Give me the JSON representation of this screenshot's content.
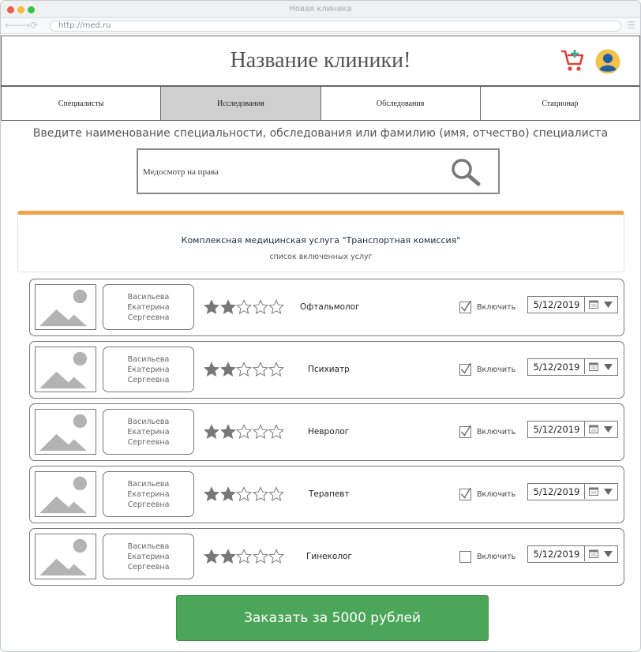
{
  "window": {
    "title": "Новая клиника",
    "url": "http://med.ru"
  },
  "header": {
    "clinic_name": "Название клиники!"
  },
  "tabs": [
    {
      "label": "Специалисты",
      "active": false
    },
    {
      "label": "Исследования",
      "active": true
    },
    {
      "label": "Обследования",
      "active": false
    },
    {
      "label": "Стационар",
      "active": false
    }
  ],
  "search": {
    "hint": "Введите наименование специальности, обследования или фамилию (имя, отчество) специалиста",
    "value": "Медосмотр на права"
  },
  "service": {
    "title": "Комплексная медицинская услуга \"Транспортная комиссия\"",
    "subtitle": "список включенных услуг"
  },
  "specialists": [
    {
      "last": "Васильева",
      "first": "Екатерина",
      "patronymic": "Сергеевна",
      "rating": 2,
      "max_rating": 5,
      "specialty": "Офтальмолог",
      "included": true,
      "include_label": "Включить",
      "date": "5/12/2019"
    },
    {
      "last": "Васильева",
      "first": "Екатерина",
      "patronymic": "Сергеевна",
      "rating": 2,
      "max_rating": 5,
      "specialty": "Психиатр",
      "included": true,
      "include_label": "Включить",
      "date": "5/12/2019"
    },
    {
      "last": "Васильева",
      "first": "Екатерина",
      "patronymic": "Сергеевна",
      "rating": 2,
      "max_rating": 5,
      "specialty": "Невролог",
      "included": true,
      "include_label": "Включить",
      "date": "5/12/2019"
    },
    {
      "last": "Васильева",
      "first": "Екатерина",
      "patronymic": "Сергеевна",
      "rating": 2,
      "max_rating": 5,
      "specialty": "Терапевт",
      "included": true,
      "include_label": "Включить",
      "date": "5/12/2019"
    },
    {
      "last": "Васильева",
      "first": "Екатерина",
      "patronymic": "Сергеевна",
      "rating": 2,
      "max_rating": 5,
      "specialty": "Гинеколог",
      "included": false,
      "include_label": "Включить",
      "date": "5/12/2019"
    }
  ],
  "order": {
    "label": "Заказать за 5000 рублей"
  },
  "icons": {
    "cart": "cart-add-icon",
    "user": "user-avatar-icon",
    "search": "magnifier-icon",
    "photo": "image-placeholder-icon",
    "calendar": "calendar-icon",
    "dropdown": "chevron-down-icon"
  },
  "colors": {
    "accent_orange": "#f0a347",
    "order_green": "#4ba65a",
    "active_tab": "#cfcfcf",
    "cart_red": "#e0413e",
    "cart_plus": "#2bb39a",
    "avatar_blue": "#1f5fa9",
    "avatar_yellow": "#f3c24a"
  }
}
